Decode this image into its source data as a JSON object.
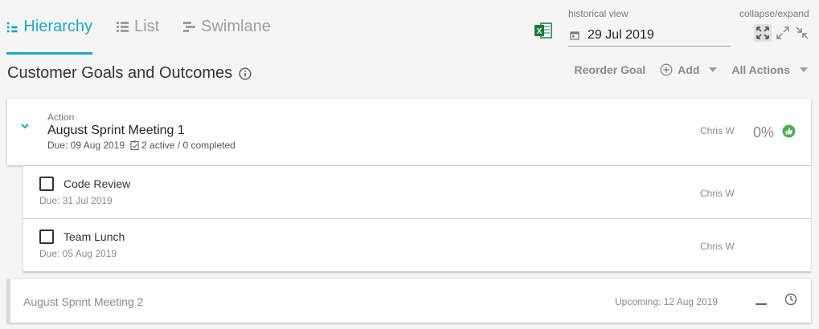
{
  "tabs": [
    {
      "label": "Hierarchy",
      "icon": "hierarchy-icon",
      "active": true
    },
    {
      "label": "List",
      "icon": "list-icon",
      "active": false
    },
    {
      "label": "Swimlane",
      "icon": "swimlane-icon",
      "active": false
    }
  ],
  "header": {
    "excel_icon": "excel-icon",
    "historical_label": "historical view",
    "historical_value": "29 Jul 2019",
    "collapse_expand_label": "collapse/expand"
  },
  "page": {
    "title": "Customer Goals and Outcomes",
    "reorder_label": "Reorder Goal",
    "add_label": "Add",
    "all_actions_label": "All Actions"
  },
  "parent_item": {
    "type_label": "Action",
    "title": "August Sprint Meeting 1",
    "due": "Due: 09 Aug 2019",
    "progress_summary": "2 active / 0 completed",
    "owner": "Chris W",
    "percent": "0%"
  },
  "children": [
    {
      "title": "Code Review",
      "due": "Due: 31 Jul 2019",
      "owner": "Chris W"
    },
    {
      "title": "Team Lunch",
      "due": "Due: 05 Aug 2019",
      "owner": "Chris W"
    }
  ],
  "upcoming_item": {
    "title": "August Sprint Meeting 2",
    "date_label": "Upcoming: 12 Aug 2019"
  },
  "colors": {
    "accent": "#1fa6c6",
    "success": "#4caf50",
    "excel": "#1d7a3e"
  }
}
